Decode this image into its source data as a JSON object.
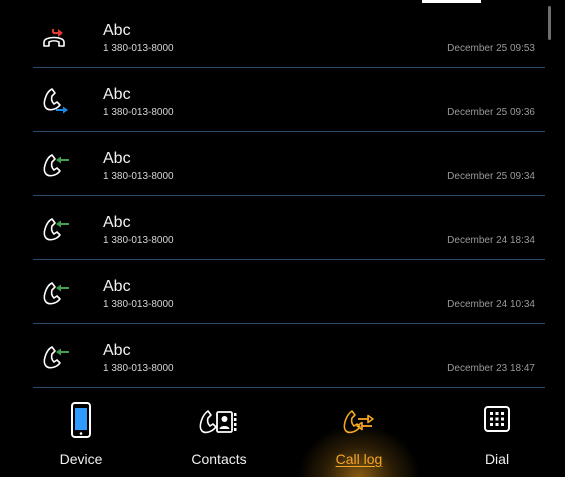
{
  "colors": {
    "background": "#000000",
    "divider": "#2b4a68",
    "accent": "#f5a623",
    "missed": "#e53935",
    "outgoing": "#1e88e5",
    "incoming": "#43a047"
  },
  "call_log": [
    {
      "name": "Abc",
      "number": "1 380-013-8000",
      "time": "December 25 09:53",
      "type": "missed",
      "icon": "missed-call-icon"
    },
    {
      "name": "Abc",
      "number": "1 380-013-8000",
      "time": "December 25 09:36",
      "type": "outgoing",
      "icon": "outgoing-call-icon"
    },
    {
      "name": "Abc",
      "number": "1 380-013-8000",
      "time": "December 25 09:34",
      "type": "incoming",
      "icon": "incoming-call-icon"
    },
    {
      "name": "Abc",
      "number": "1 380-013-8000",
      "time": "December 24 18:34",
      "type": "incoming",
      "icon": "incoming-call-icon"
    },
    {
      "name": "Abc",
      "number": "1 380-013-8000",
      "time": "December 24 10:34",
      "type": "incoming",
      "icon": "incoming-call-icon"
    },
    {
      "name": "Abc",
      "number": "1 380-013-8000",
      "time": "December 23 18:47",
      "type": "incoming",
      "icon": "incoming-call-icon"
    }
  ],
  "nav": {
    "items": [
      {
        "label": "Device",
        "icon": "phone-device-icon",
        "active": false
      },
      {
        "label": "Contacts",
        "icon": "contacts-icon",
        "active": false
      },
      {
        "label": "Call log",
        "icon": "call-log-icon",
        "active": true
      },
      {
        "label": "Dial",
        "icon": "dialpad-icon",
        "active": false
      }
    ]
  }
}
